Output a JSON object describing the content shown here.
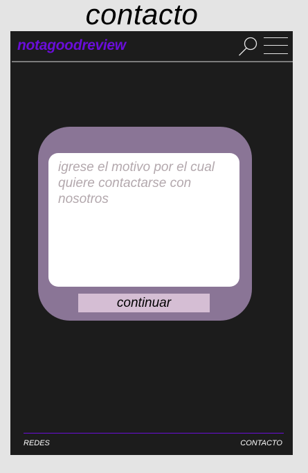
{
  "page": {
    "heading": "contacto"
  },
  "header": {
    "brand": "notagoodreview",
    "search_icon": "magnifier-icon",
    "menu_icon": "hamburger-menu-icon"
  },
  "contact_form": {
    "message_placeholder": "igrese el motivo por el cual quiere contactarse con nosotros",
    "message_value": "",
    "submit_label": "continuar"
  },
  "footer": {
    "links": [
      "REDES",
      "CONTACTO"
    ]
  },
  "colors": {
    "page_background": "#e4e4e4",
    "app_background": "#1c1c1c",
    "brand_accent": "#6a0dd9",
    "card_background": "#8a7596",
    "button_background": "#d5bed4",
    "placeholder_text": "#b3a8ad"
  }
}
